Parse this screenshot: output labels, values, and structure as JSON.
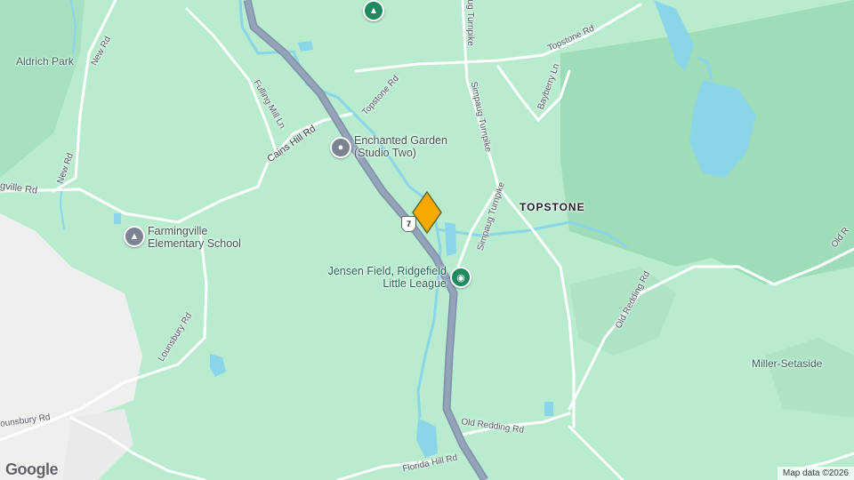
{
  "map": {
    "roads": {
      "new_rd_top": "New Rd",
      "new_rd_left": "New Rd",
      "fulling_mill_ln": "Fulling Mill Ln",
      "cains_hill_rd": "Cains Hill Rd",
      "topstone_rd_mid": "Topstone Rd",
      "topstone_rd_right": "Topstone Rd",
      "simpaug_turnpike_top": "Simpaug Turnpike",
      "simpaug_turnpike_mid": "Simpaug Turnpike",
      "bayberry_ln": "Bayberry Ln",
      "farmingville_rd": "gville Rd",
      "lounsbury_rd_mid": "Lounsbury Rd",
      "lounsbury_rd_bottom": "ounsbury Rd",
      "old_redding_rd_bottom": "Old Redding Rd",
      "old_redding_rd_right": "Old Redding Rd",
      "old_rd_edge": "Old R",
      "florida_hill_rd": "Florida Hill Rd",
      "route_shield": "7"
    },
    "places": {
      "aldrich_park": "Aldrich Park",
      "topstone": "TOPSTONE",
      "miller_setaside": "Miller-Setaside"
    },
    "pois": {
      "enchanted_garden_line1": "Enchanted Garden",
      "enchanted_garden_line2": "(Studio Two)",
      "farmingville_school_line1": "Farmingville",
      "farmingville_school_line2": "Elementary School",
      "jensen_field_line1": "Jensen Field, Ridgefield",
      "jensen_field_line2": "Little League"
    },
    "colors": {
      "land": "#b9eccf",
      "forest": "#a3dfbd",
      "water": "#8ad5e8",
      "highway": "#8a9bb0",
      "marker": "#f8a800"
    },
    "attribution": "Map data ©2026",
    "logo": "Google"
  }
}
